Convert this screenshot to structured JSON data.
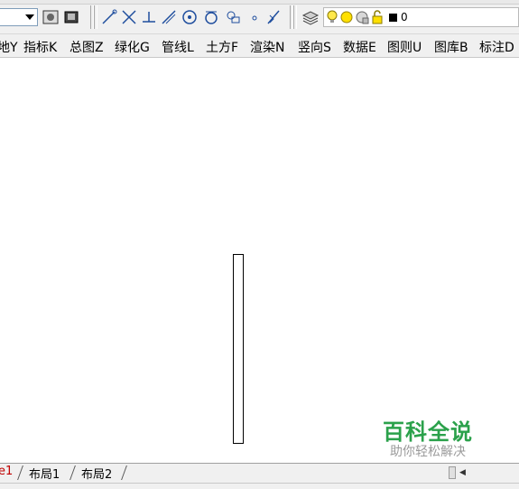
{
  "layer": {
    "current_name": "0"
  },
  "menu": {
    "items": [
      {
        "label": "地Y"
      },
      {
        "label": "指标K"
      },
      {
        "label": "总图Z"
      },
      {
        "label": "绿化G"
      },
      {
        "label": "管线L"
      },
      {
        "label": "土方F"
      },
      {
        "label": "渲染N"
      },
      {
        "label": "竖向S"
      },
      {
        "label": "数据E"
      },
      {
        "label": "图则U"
      },
      {
        "label": "图库B"
      },
      {
        "label": "标注D"
      }
    ]
  },
  "tabs": {
    "current": "e1",
    "layout1": "布局1",
    "layout2": "布局2"
  },
  "watermark": {
    "title": "百科全说",
    "subtitle": "助你轻松解决"
  },
  "colors": {
    "watermark_green": "#2ba14b",
    "current_tab": "#c00000"
  }
}
